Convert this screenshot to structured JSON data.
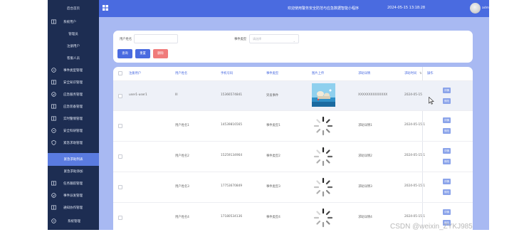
{
  "header": {
    "title": "欢迎使用警务安全防范与应急数据智能小程序",
    "datetime": "2024-05-15 13:18:28",
    "user": "admin"
  },
  "sidebar": {
    "items": [
      {
        "label": "后台首页",
        "icon": "home-icon"
      },
      {
        "label": "系统用户",
        "icon": "book-icon"
      },
      {
        "label": "管理员",
        "icon": ""
      },
      {
        "label": "注册用户",
        "icon": ""
      },
      {
        "label": "客服人员",
        "icon": ""
      },
      {
        "label": "事件类型管理",
        "icon": "chat-icon"
      },
      {
        "label": "安全知识管理",
        "icon": "book-icon"
      },
      {
        "label": "应急服务管理",
        "icon": "check-circle-icon"
      },
      {
        "label": "应急装备管理",
        "icon": "book-icon"
      },
      {
        "label": "实时警情管理",
        "icon": "book-icon"
      },
      {
        "label": "安全科研管理",
        "icon": "chat-icon"
      },
      {
        "label": "紧急求助管理",
        "icon": "shield-icon"
      },
      {
        "label": "紧急求助列表",
        "icon": ""
      },
      {
        "label": "紧急求助添加",
        "icon": ""
      },
      {
        "label": "任务跟踪管理",
        "icon": "book-icon"
      },
      {
        "label": "事件派发管理",
        "icon": "check-circle-icon"
      },
      {
        "label": "通知协作管理",
        "icon": "book-icon"
      },
      {
        "label": "系统管理",
        "icon": "chat-icon"
      }
    ]
  },
  "search": {
    "user_label": "用户姓名",
    "type_label": "事件类型",
    "type_placeholder": "请选择",
    "query_button": "查询",
    "reset_button": "重置",
    "delete_button": "删除"
  },
  "table": {
    "headers": [
      "注册用户",
      "用户姓名",
      "手机号码",
      "事件类型",
      "图片上传",
      "求助详情",
      "求助时间",
      "操作"
    ],
    "detail_button": "详情",
    "edit_button": "修改",
    "rows": [
      {
        "user": "user1-user1",
        "name": "lll",
        "phone": "15366574841",
        "type": "突发事件",
        "detail": "XXXXXXXXXXXXXX",
        "time": "2024-05-15",
        "image": "photo"
      },
      {
        "user": "",
        "name": "用户姓名1",
        "phone": "14539816565",
        "type": "事件类型1",
        "detail": "求助详情1",
        "time": "2024-05-15 1",
        "image": "loading"
      },
      {
        "user": "",
        "name": "用户姓名2",
        "phone": "15259134964",
        "type": "事件类型2",
        "detail": "求助详情2",
        "time": "2024-05-15 1",
        "image": "loading"
      },
      {
        "user": "",
        "name": "用户姓名3",
        "phone": "17753670849",
        "type": "事件类型3",
        "detail": "求助详情3",
        "time": "2024-05-15 1",
        "image": "loading"
      },
      {
        "user": "",
        "name": "用户姓名4",
        "phone": "17180534136",
        "type": "事件类型4",
        "detail": "求助详情4",
        "time": "2024-05-15 1",
        "image": "loading"
      }
    ]
  },
  "watermark": "CSDN @weixin_ZYKJ985",
  "colors": {
    "sidebar_bg": "#1d2d52",
    "sidebar_active": "#5a7be0",
    "topbar_bg": "#4a6be0",
    "main_bg": "#a8b9f2",
    "query_button": "#4a6be0",
    "reset_button": "#4a6be0",
    "delete_button": "#f07b7b",
    "action_button": "#8aa3ea"
  }
}
